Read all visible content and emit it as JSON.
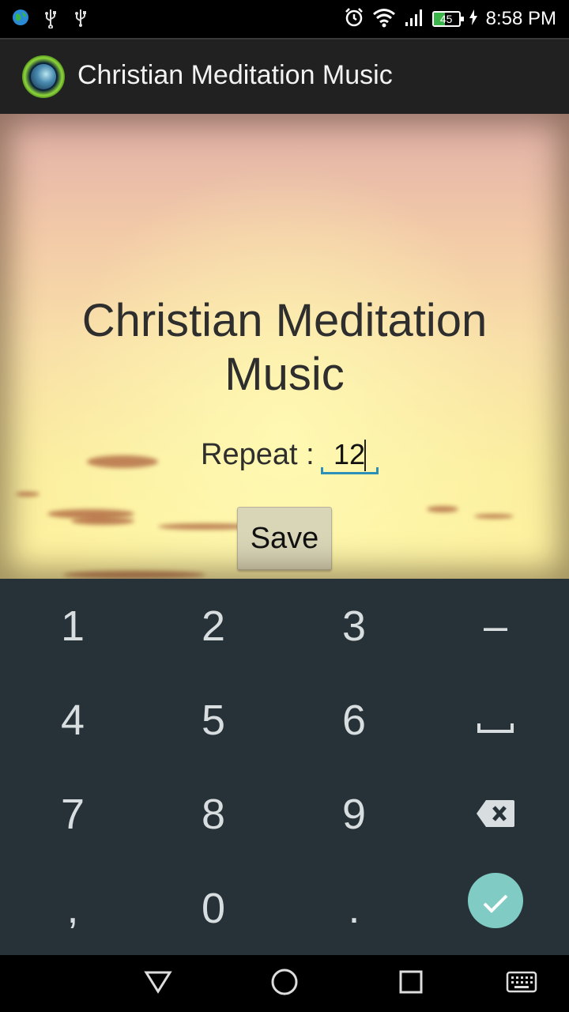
{
  "status_bar": {
    "time": "8:58 PM",
    "battery_level": "45",
    "battery_color": "#3bb54a",
    "left_icons": [
      "globe-icon",
      "usb-icon",
      "usb-icon"
    ],
    "right_icons": [
      "alarm-icon",
      "wifi-icon",
      "signal-icon",
      "battery-icon",
      "charging-icon"
    ]
  },
  "app_bar": {
    "title": "Christian Meditation Music",
    "logo": "app-logo-icon"
  },
  "main": {
    "title": "Christian Meditation Music",
    "repeat_label": "Repeat :",
    "repeat_value": "12",
    "save_label": "Save",
    "accent_color": "#2b8fb8"
  },
  "keyboard": {
    "keys": [
      {
        "label": "1"
      },
      {
        "label": "2"
      },
      {
        "label": "3"
      },
      {
        "label": "–"
      },
      {
        "label": "4"
      },
      {
        "label": "5"
      },
      {
        "label": "6"
      },
      {
        "label": "",
        "icon": "space-icon"
      },
      {
        "label": "7"
      },
      {
        "label": "8"
      },
      {
        "label": "9"
      },
      {
        "label": "",
        "icon": "backspace-icon"
      },
      {
        "label": ","
      },
      {
        "label": "0"
      },
      {
        "label": "."
      },
      {
        "label": "",
        "icon": "check-icon"
      }
    ],
    "background_color": "#263238",
    "check_color": "#80cbc4"
  },
  "nav_bar": {
    "buttons": [
      "back-icon",
      "home-icon",
      "recents-icon",
      "keyboard-icon"
    ]
  }
}
